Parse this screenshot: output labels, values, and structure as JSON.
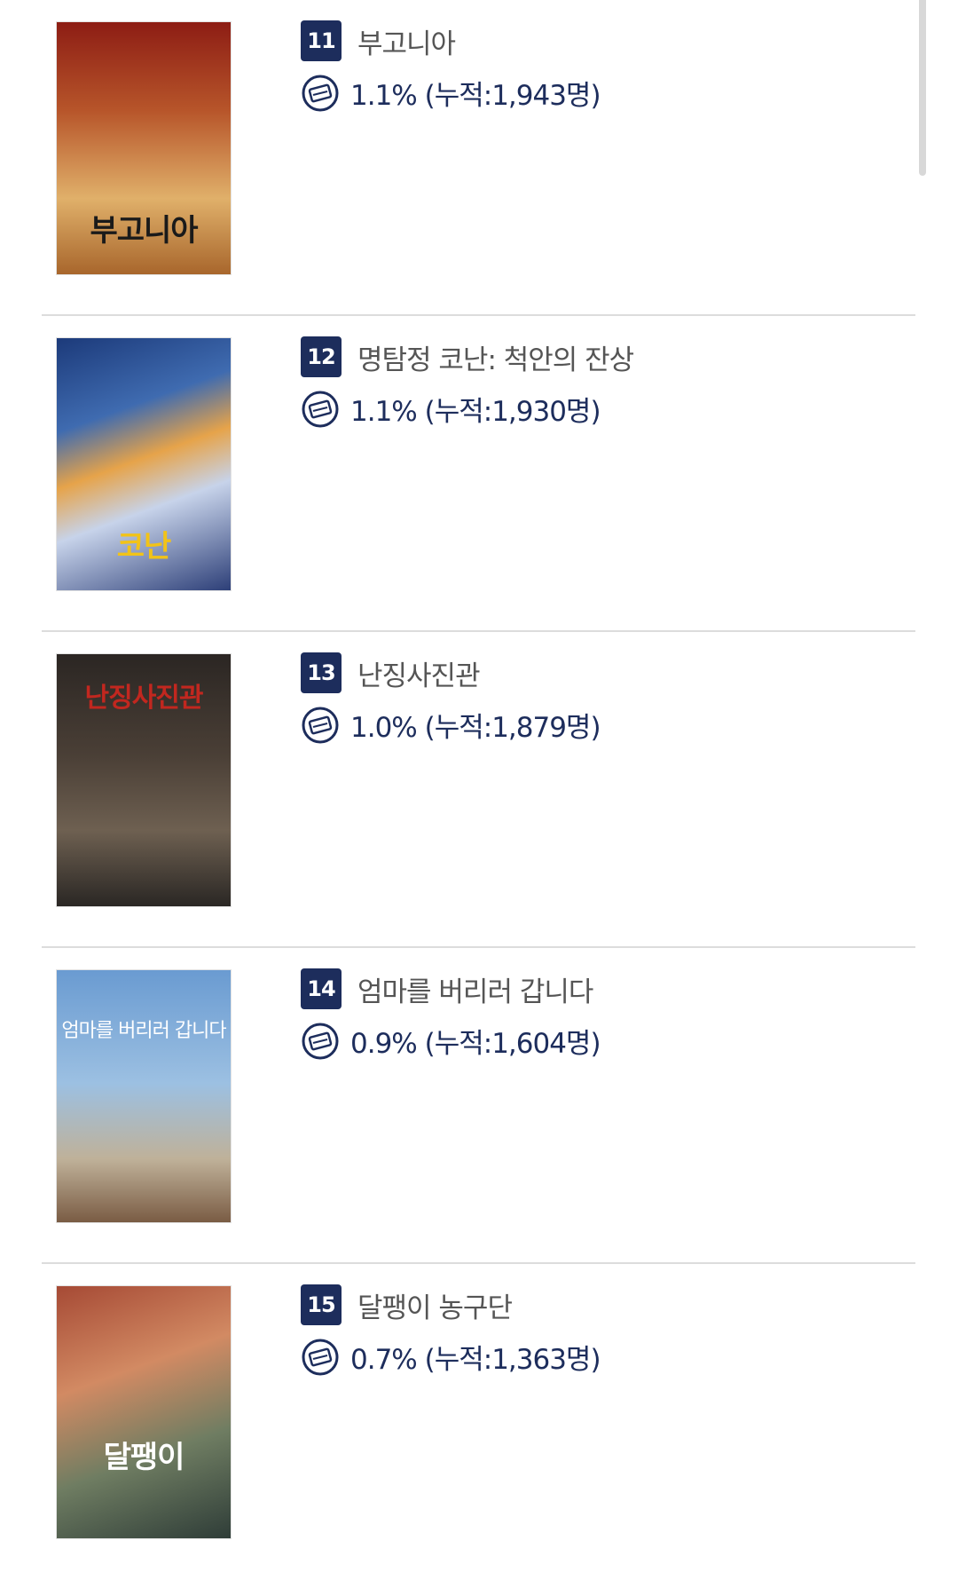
{
  "movies": [
    {
      "rank": "11",
      "title": "부고니아",
      "share": "1.1% (누적:1,943명)",
      "poster_text": "부고니아",
      "poster_colors": [
        "#8d1d14",
        "#c98a3c"
      ]
    },
    {
      "rank": "12",
      "title": "명탐정 코난: 척안의 잔상",
      "share": "1.1% (누적:1,930명)",
      "poster_text": "코난",
      "poster_colors": [
        "#274a8c",
        "#d8b2c6"
      ]
    },
    {
      "rank": "13",
      "title": "난징사진관",
      "share": "1.0% (누적:1,879명)",
      "poster_text": "난징사진관",
      "poster_colors": [
        "#2a2724",
        "#6b5b4a"
      ]
    },
    {
      "rank": "14",
      "title": "엄마를 버리러 갑니다",
      "share": "0.9% (누적:1,604명)",
      "poster_text": "엄마를 버리러 갑니다",
      "poster_colors": [
        "#7da6d4",
        "#c7b39a"
      ]
    },
    {
      "rank": "15",
      "title": "달팽이 농구단",
      "share": "0.7% (누적:1,363명)",
      "poster_text": "달팽이",
      "poster_colors": [
        "#b0533c",
        "#2f4d4a"
      ]
    }
  ],
  "icons": {
    "ticket": "ticket-icon"
  },
  "colors": {
    "rank_badge": "#1d2d5c",
    "share_text": "#1d2d5c"
  }
}
